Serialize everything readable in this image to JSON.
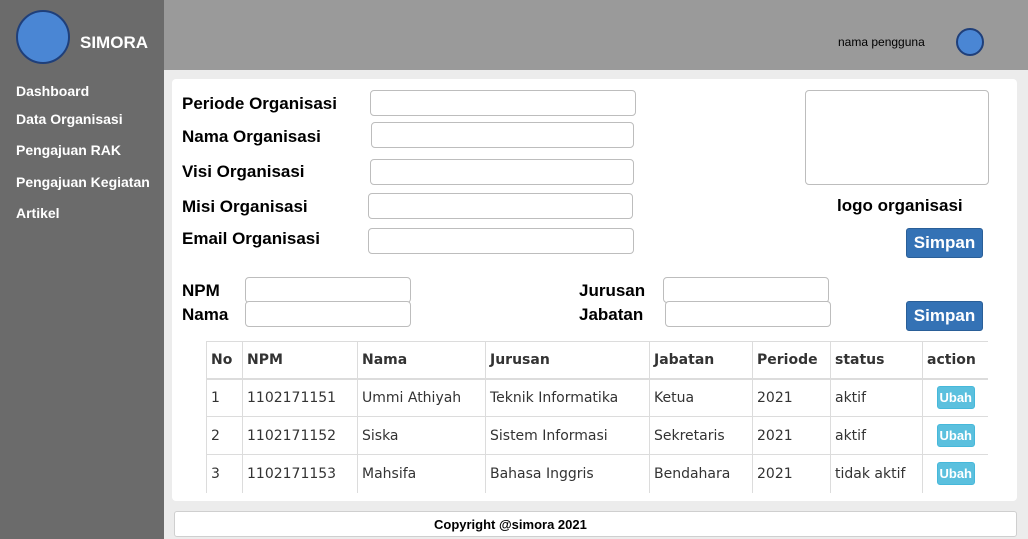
{
  "app": {
    "name": "SIMORA"
  },
  "sidebar": {
    "items": [
      {
        "label": "Dashboard"
      },
      {
        "label": "Data Organisasi"
      },
      {
        "label": "Pengajuan RAK"
      },
      {
        "label": "Pengajuan Kegiatan"
      },
      {
        "label": "Artikel"
      }
    ]
  },
  "header": {
    "username": "nama pengguna",
    "avatar_icon": "user-avatar-icon"
  },
  "org_form": {
    "periode_label": "Periode Organisasi",
    "periode_value": "",
    "nama_label": "Nama Organisasi",
    "nama_value": "",
    "visi_label": "Visi Organisasi",
    "visi_value": "",
    "misi_label": "Misi Organisasi",
    "misi_value": "",
    "email_label": "Email Organisasi",
    "email_value": "",
    "logo_label": "logo organisasi",
    "save_label": "Simpan"
  },
  "member_form": {
    "npm_label": "NPM",
    "npm_value": "",
    "nama_label": "Nama",
    "nama_value": "",
    "jurusan_label": "Jurusan",
    "jurusan_value": "",
    "jabatan_label": "Jabatan",
    "jabatan_value": "",
    "save_label": "Simpan"
  },
  "table": {
    "columns": [
      "No",
      "NPM",
      "Nama",
      "Jurusan",
      "Jabatan",
      "Periode",
      "status",
      "action"
    ],
    "rows": [
      [
        "1",
        "1102171151",
        "Ummi Athiyah",
        "Teknik Informatika",
        "Ketua",
        "2021",
        "aktif"
      ],
      [
        "2",
        "1102171152",
        "Siska",
        "Sistem Informasi",
        "Sekretaris",
        "2021",
        "aktif"
      ],
      [
        "3",
        "1102171153",
        "Mahsifa",
        "Bahasa Inggris",
        "Bendahara",
        "2021",
        "tidak aktif"
      ]
    ],
    "action_label": "Ubah"
  },
  "footer": {
    "text": "Copyright @simora 2021"
  },
  "colors": {
    "sidebar": "#6b6b6b",
    "topbar": "#9a9a9a",
    "primary": "#3472b5",
    "info": "#5bc0de",
    "avatar": "#4a86d4"
  }
}
